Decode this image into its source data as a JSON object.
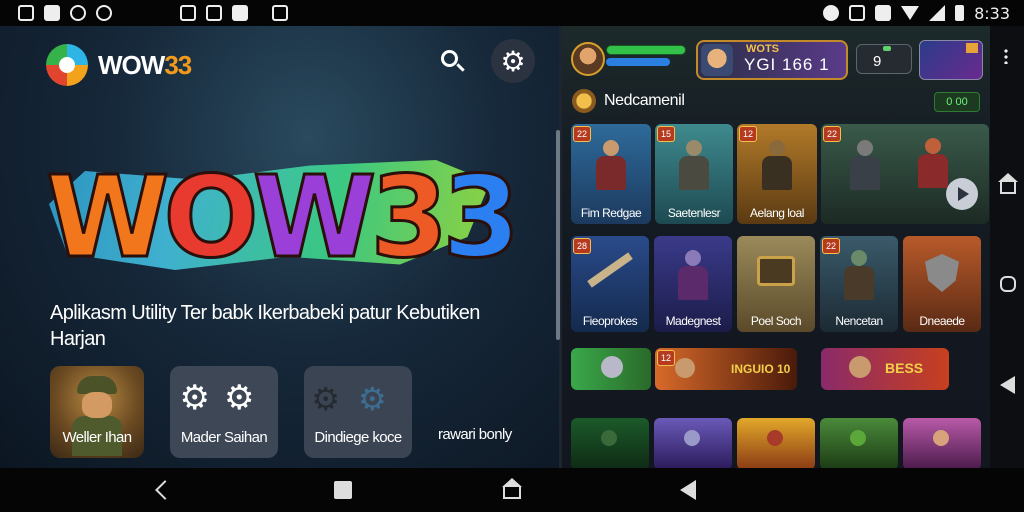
{
  "status_bar": {
    "time": "8:33"
  },
  "app": {
    "logo_text_main": "WOW",
    "logo_text_accent": "33",
    "hero_letters": [
      "W",
      "O",
      "W",
      "3",
      "3"
    ],
    "tagline": "Aplikasm Utility Ter babk Ikerbabeki patur Kebutiken Harjan",
    "tiles": [
      {
        "label": "Weller Ihan"
      },
      {
        "label": "Mader Saihan"
      },
      {
        "label": "Dindiege koce"
      },
      {
        "label": "rawari bonly"
      }
    ]
  },
  "game": {
    "player_label": "WOTS",
    "player_score": "YGI 166 1",
    "coins": "9",
    "section_title": "Nedcamenil",
    "section_badge": "0 00",
    "row1": [
      {
        "badge": "22",
        "label": "Fim Redgae"
      },
      {
        "badge": "15",
        "label": "Saetenlesr"
      },
      {
        "badge": "12",
        "label": "Aelang loal"
      },
      {
        "badge": "22",
        "label": ""
      }
    ],
    "row2": [
      {
        "badge": "28",
        "label": "Fieoprokes"
      },
      {
        "badge": "",
        "label": "Madegnest"
      },
      {
        "badge": "",
        "label": "Poel Soch"
      },
      {
        "badge": "22",
        "label": "Nencetan"
      },
      {
        "badge": "",
        "label": "Dneaede"
      }
    ],
    "row3": [
      {
        "badge": "",
        "label": ""
      },
      {
        "badge": "12",
        "label": "INGUIO 10"
      },
      {
        "badge": "",
        "label": "BESS"
      }
    ],
    "row4": [
      {
        "badge": "",
        "label": ""
      },
      {
        "badge": "",
        "label": ""
      },
      {
        "badge": "",
        "label": ""
      },
      {
        "badge": "",
        "label": ""
      },
      {
        "badge": "",
        "label": ""
      }
    ]
  }
}
